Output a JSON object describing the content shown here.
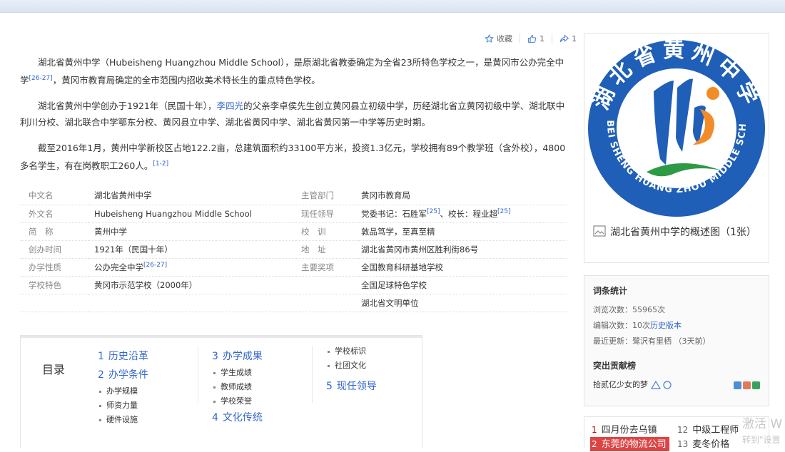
{
  "actions": {
    "favorite": "收藏",
    "like_count": "1",
    "share_count": "1"
  },
  "intro": {
    "p1_a": "湖北省黄州中学（Hubeisheng Huangzhou Middle School），是原湖北省教委确定为全省23所特色学校之一，是黄冈市公办完全中学",
    "p1_ref": "[26-27]",
    "p1_b": "，黄冈市教育局确定的全市范围内招收美术特长生的重点特色学校。",
    "p2_a": "湖北省黄州中学创办于1921年（民国十年），",
    "p2_link": "李四光",
    "p2_b": "的父亲李卓侯先生创立黄冈县立初级中学，历经湖北省立黄冈初级中学、湖北联中利川分校、湖北联合中学鄂东分校、黄冈县立中学、湖北省黄冈中学、湖北省黄冈第一中学等历史时期。",
    "p3_a": "截至2016年1月，黄州中学新校区占地122.2亩，总建筑面积约33100平方米，投资1.3亿元，学校拥有89个教学班（含外校），4800多名学生，有在岗教职工260人。",
    "p3_ref": "[1-2]"
  },
  "basic_info": {
    "rows": [
      {
        "k": "中文名",
        "v": "湖北省黄州中学",
        "k2": "主管部门",
        "v2": "黄冈市教育局"
      },
      {
        "k": "外文名",
        "v": "Hubeisheng Huangzhou Middle School",
        "k2": "现任领导",
        "v2": "党委书记：石胜军",
        "v2_ref": "[25]",
        "v2_b": "、校长：程业超",
        "v2_ref2": "[25]"
      },
      {
        "k": "简　称",
        "v": "黄州中学",
        "k2": "校　训",
        "v2": "敦品笃学，至真至精"
      },
      {
        "k": "创办时间",
        "v": "1921年（民国十年）",
        "k2": "地　址",
        "v2": "湖北省黄冈市黄州区胜利街86号"
      },
      {
        "k": "办学性质",
        "v": "公办完全中学",
        "v_ref": "[26-27]",
        "k2": "主要奖项",
        "v2": "全国教育科研基地学校"
      },
      {
        "k": "学校特色",
        "v": "黄冈市示范学校（2000年）",
        "k2": "",
        "v2": "全国足球特色学校"
      },
      {
        "k": "",
        "v": "",
        "k2": "",
        "v2": "湖北省文明单位"
      }
    ]
  },
  "toc": {
    "title": "目录",
    "col1": [
      {
        "n": "1",
        "label": "历史沿革",
        "subs": []
      },
      {
        "n": "2",
        "label": "办学条件",
        "subs": [
          "办学规模",
          "师资力量",
          "硬件设施"
        ]
      }
    ],
    "col2": [
      {
        "n": "3",
        "label": "办学成果",
        "subs": [
          "学生成绩",
          "教师成绩",
          "学校荣誉"
        ]
      },
      {
        "n": "4",
        "label": "文化传统",
        "subs": []
      }
    ],
    "col3_subs": [
      "学校标识",
      "社团文化"
    ],
    "col3": [
      {
        "n": "5",
        "label": "现任领导",
        "subs": []
      }
    ]
  },
  "logo": {
    "top_text": "湖北省黄州中学",
    "ring_text": "HU BEI SHENG HUANG ZHOU MIDDLE SCHOOL",
    "ring_color": "#1f5fb8",
    "orange": "#f28c28",
    "green": "#2e9a45"
  },
  "picture": {
    "caption": "湖北省黄州中学的概述图（1张）"
  },
  "stats": {
    "title": "词条统计",
    "views_label": "浏览次数：",
    "views": "55965次",
    "edits_label": "编辑次数：",
    "edits": "10次",
    "history_link": "历史版本",
    "updated_label": "最近更新：",
    "updated_user": "鹭沢有里栖",
    "updated_when": "（3天前）",
    "contrib_title": "突出贡献榜",
    "contrib_user": "拾贰亿少女的梦"
  },
  "hot": {
    "items": [
      {
        "n": "1",
        "label": "四月份去乌镇"
      },
      {
        "n": "12",
        "label": "中级工程师"
      },
      {
        "n": "2",
        "label": "东莞的物流公司"
      },
      {
        "n": "13",
        "label": "麦冬价格"
      }
    ]
  },
  "watermark": {
    "line1": "激活 W",
    "line2": "转到\"设置"
  }
}
